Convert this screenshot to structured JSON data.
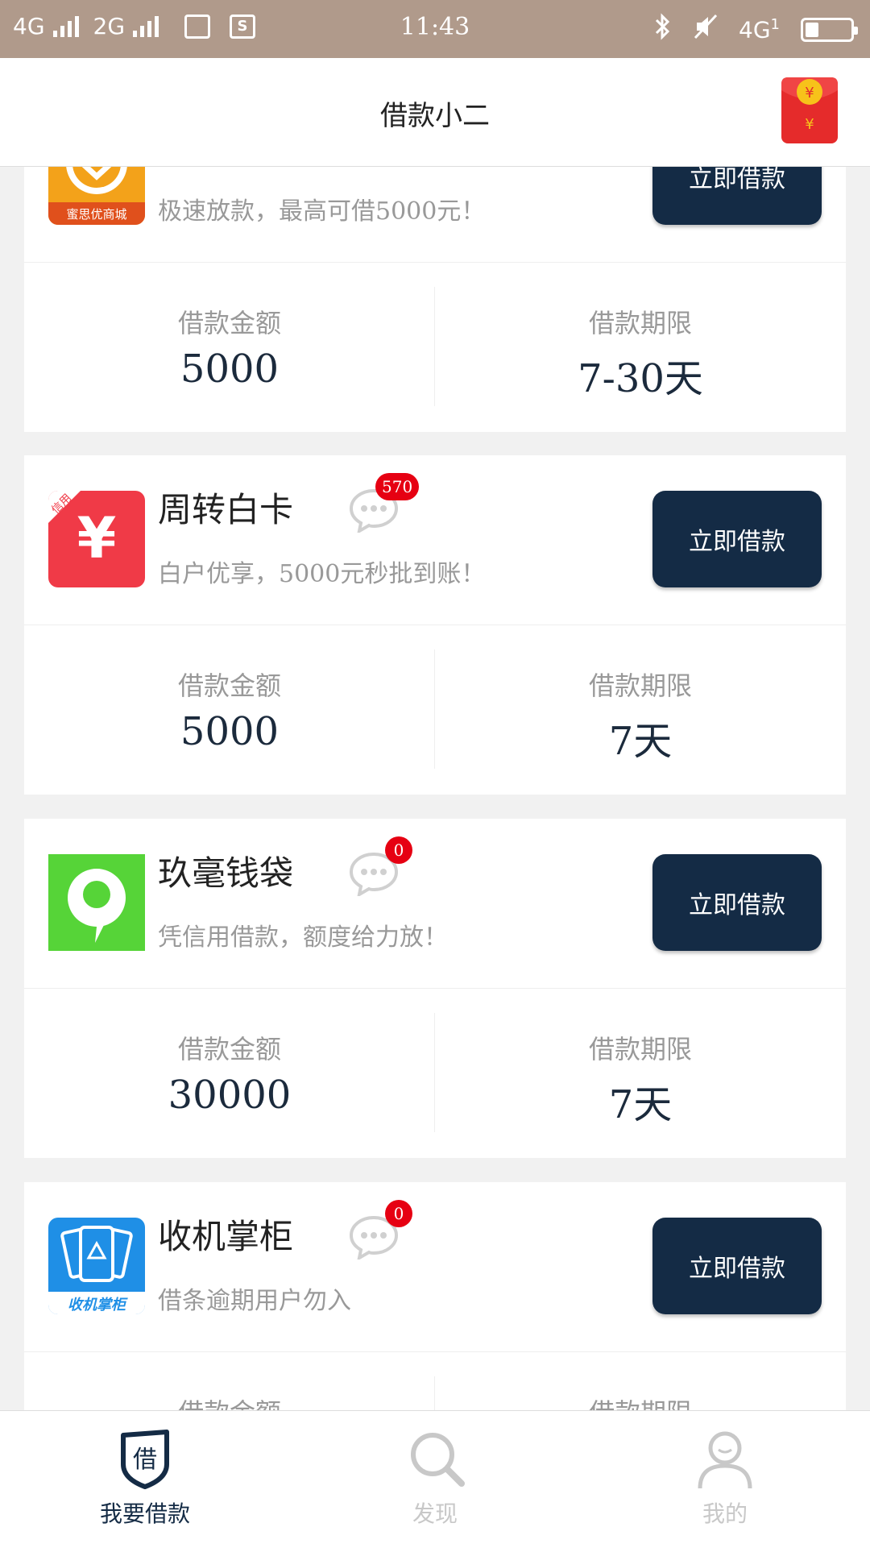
{
  "status_bar": {
    "net1": "4G",
    "net2": "2G",
    "time": "11:43",
    "net_right": "4G",
    "sim_index": "1",
    "battery_level": 0.3
  },
  "header": {
    "title": "借款小二"
  },
  "cards": [
    {
      "logo_text": "蜜思优商城",
      "desc": "极速放款，最高可借5000元！",
      "button": "立即借款",
      "amount_label": "借款金额",
      "amount": "5000",
      "term_label": "借款期限",
      "term": "7-30天"
    },
    {
      "name": "周转白卡",
      "badge": "570",
      "logo_tag": "信用",
      "logo_symbol": "¥",
      "desc": "白户优享，5000元秒批到账！",
      "button": "立即借款",
      "amount_label": "借款金额",
      "amount": "5000",
      "term_label": "借款期限",
      "term": "7天"
    },
    {
      "name": "玖毫钱袋",
      "badge": "0",
      "desc": "凭信用借款，额度给力放！",
      "button": "立即借款",
      "amount_label": "借款金额",
      "amount": "30000",
      "term_label": "借款期限",
      "term": "7天"
    },
    {
      "name": "收机掌柜",
      "badge": "0",
      "logo_text": "收机掌柜",
      "desc": "借条逾期用户勿入",
      "button": "立即借款",
      "amount_label": "借款金额",
      "term_label": "借款期限"
    }
  ],
  "nav": [
    {
      "label": "我要借款",
      "icon_char": "借",
      "icon": "shield-icon",
      "active": true
    },
    {
      "label": "发现",
      "icon": "search-icon",
      "active": false
    },
    {
      "label": "我的",
      "icon": "user-icon",
      "active": false
    }
  ],
  "colors": {
    "status_bar": "#b09a8b",
    "button": "#142b45",
    "badge": "#e60012",
    "background": "#f1f1f1"
  }
}
